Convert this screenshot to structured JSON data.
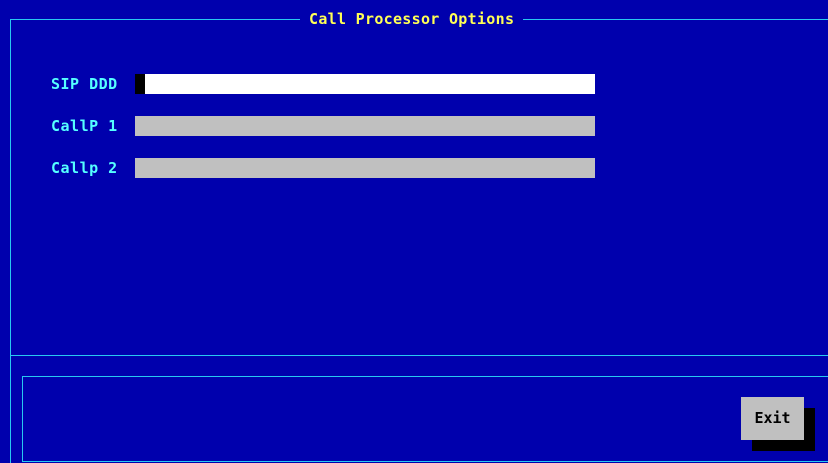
{
  "dialog": {
    "title": "Call Processor Options"
  },
  "fields": [
    {
      "label": "SIP DDD",
      "value": "",
      "active": true
    },
    {
      "label": "CallP 1",
      "value": "",
      "active": false
    },
    {
      "label": "Callp 2",
      "value": "",
      "active": false
    }
  ],
  "footer": {
    "exit_label": "Exit"
  },
  "colors": {
    "background": "#0000ad",
    "frame": "#28c8f0",
    "title": "#ffff55",
    "label": "#55ffff",
    "field_active": "#ffffff",
    "field_inactive": "#c0c0c0",
    "button": "#c0c0c0"
  }
}
